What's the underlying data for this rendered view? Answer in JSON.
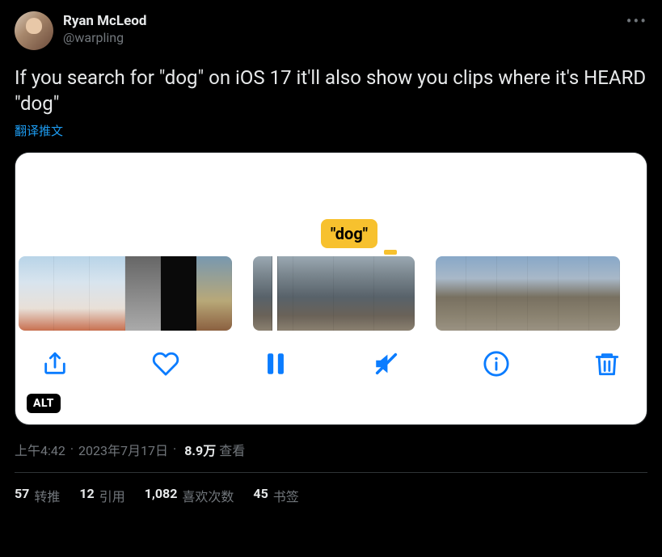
{
  "author": {
    "display_name": "Ryan McLeod",
    "handle": "@warpling"
  },
  "content": {
    "text": "If you search for \"dog\" on iOS 17 it'll also show you clips where it's HEARD \"dog\"",
    "translate_label": "翻译推文"
  },
  "media": {
    "caption_bubble": "\"dog\"",
    "alt_badge": "ALT",
    "toolbar_icons": {
      "share": "share-icon",
      "heart": "heart-icon",
      "pause": "pause-icon",
      "mute": "mute-icon",
      "info": "info-icon",
      "trash": "trash-icon"
    }
  },
  "meta": {
    "time": "上午4:42",
    "date": "2023年7月17日",
    "views_number": "8.9万",
    "views_label": "查看"
  },
  "stats": {
    "retweets": {
      "n": "57",
      "label": "转推"
    },
    "quotes": {
      "n": "12",
      "label": "引用"
    },
    "likes": {
      "n": "1,082",
      "label": "喜欢次数"
    },
    "bookmarks": {
      "n": "45",
      "label": "书签"
    }
  }
}
